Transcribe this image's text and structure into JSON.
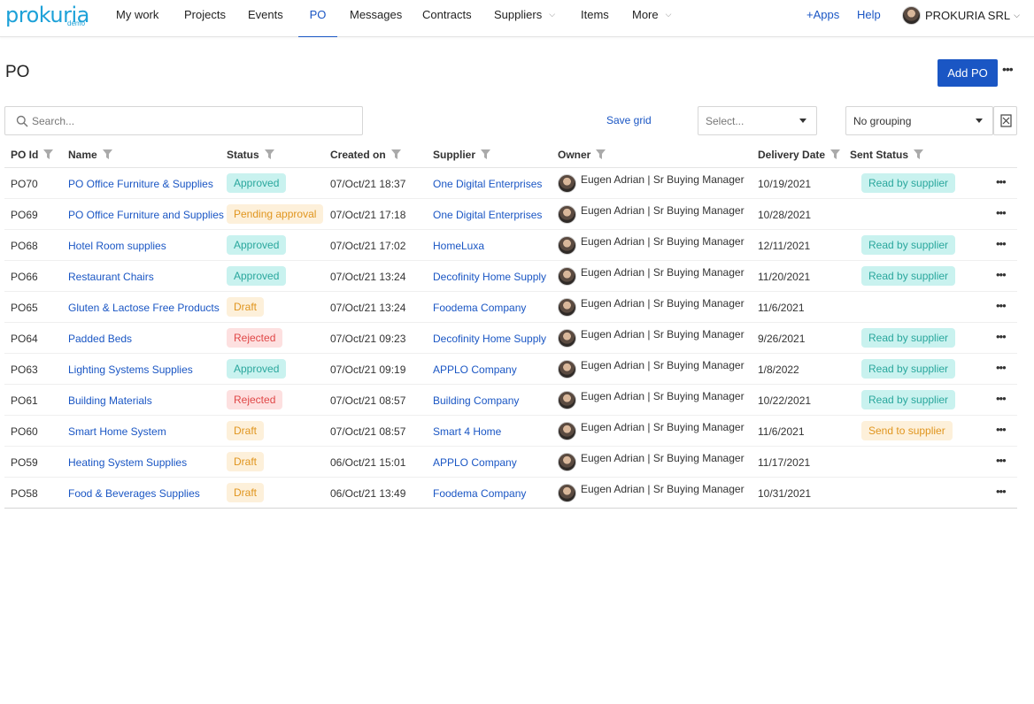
{
  "app": {
    "logo": "prokuria",
    "logo_sub": "demo"
  },
  "nav": {
    "items": [
      {
        "label": "My work"
      },
      {
        "label": "Projects"
      },
      {
        "label": "Events"
      },
      {
        "label": "PO",
        "active": true
      },
      {
        "label": "Messages"
      },
      {
        "label": "Contracts"
      },
      {
        "label": "Suppliers",
        "dropdown": true
      },
      {
        "label": "Items"
      },
      {
        "label": "More",
        "dropdown": true
      }
    ],
    "apps_label": "+Apps",
    "help_label": "Help",
    "user_label": "PROKURIA SRL"
  },
  "page": {
    "title": "PO",
    "add_button": "Add PO",
    "more_icon": "ellipsis-icon"
  },
  "toolbar": {
    "search_placeholder": "Search...",
    "search_value": "",
    "save_grid_label": "Save grid",
    "select_placeholder": "Select...",
    "grouping_value": "No grouping",
    "export_icon": "excel-export-icon"
  },
  "table": {
    "columns": [
      "PO Id",
      "Name",
      "Status",
      "Created on",
      "Supplier",
      "Owner",
      "Delivery Date",
      "Sent Status"
    ],
    "rows": [
      {
        "id": "PO70",
        "name": "PO Office Furniture & Supplies",
        "status": "Approved",
        "created": "07/Oct/21 18:37",
        "supplier": "One Digital Enterprises",
        "owner": "Eugen Adrian | Sr Buying Manager",
        "delivery": "10/19/2021",
        "sent": "Read by supplier"
      },
      {
        "id": "PO69",
        "name": "PO Office Furniture and Supplies",
        "status": "Pending approval",
        "created": "07/Oct/21 17:18",
        "supplier": "One Digital Enterprises",
        "owner": "Eugen Adrian | Sr Buying Manager",
        "delivery": "10/28/2021",
        "sent": ""
      },
      {
        "id": "PO68",
        "name": "Hotel Room supplies",
        "status": "Approved",
        "created": "07/Oct/21 17:02",
        "supplier": "HomeLuxa",
        "owner": "Eugen Adrian | Sr Buying Manager",
        "delivery": "12/11/2021",
        "sent": "Read by supplier"
      },
      {
        "id": "PO66",
        "name": "Restaurant Chairs",
        "status": "Approved",
        "created": "07/Oct/21 13:24",
        "supplier": "Decofinity Home Supply",
        "owner": "Eugen Adrian | Sr Buying Manager",
        "delivery": "11/20/2021",
        "sent": "Read by supplier"
      },
      {
        "id": "PO65",
        "name": "Gluten & Lactose Free Products",
        "status": "Draft",
        "created": "07/Oct/21 13:24",
        "supplier": "Foodema Company",
        "owner": "Eugen Adrian | Sr Buying Manager",
        "delivery": "11/6/2021",
        "sent": ""
      },
      {
        "id": "PO64",
        "name": "Padded Beds",
        "status": "Rejected",
        "created": "07/Oct/21 09:23",
        "supplier": "Decofinity Home Supply",
        "owner": "Eugen Adrian | Sr Buying Manager",
        "delivery": "9/26/2021",
        "sent": "Read by supplier"
      },
      {
        "id": "PO63",
        "name": "Lighting Systems Supplies",
        "status": "Approved",
        "created": "07/Oct/21 09:19",
        "supplier": "APPLO Company",
        "owner": "Eugen Adrian | Sr Buying Manager",
        "delivery": "1/8/2022",
        "sent": "Read by supplier"
      },
      {
        "id": "PO61",
        "name": "Building Materials",
        "status": "Rejected",
        "created": "07/Oct/21 08:57",
        "supplier": "Building Company",
        "owner": "Eugen Adrian | Sr Buying Manager",
        "delivery": "10/22/2021",
        "sent": "Read by supplier"
      },
      {
        "id": "PO60",
        "name": "Smart Home System",
        "status": "Draft",
        "created": "07/Oct/21 08:57",
        "supplier": "Smart 4 Home",
        "owner": "Eugen Adrian | Sr Buying Manager",
        "delivery": "11/6/2021",
        "sent": "Send to supplier"
      },
      {
        "id": "PO59",
        "name": "Heating System Supplies",
        "status": "Draft",
        "created": "06/Oct/21 15:01",
        "supplier": "APPLO Company",
        "owner": "Eugen Adrian | Sr Buying Manager",
        "delivery": "11/17/2021",
        "sent": ""
      },
      {
        "id": "PO58",
        "name": "Food & Beverages Supplies",
        "status": "Draft",
        "created": "06/Oct/21 13:49",
        "supplier": "Foodema Company",
        "owner": "Eugen Adrian | Sr Buying Manager",
        "delivery": "10/31/2021",
        "sent": ""
      }
    ]
  },
  "colors": {
    "accent": "#1a56c4",
    "approved_bg": "#c9f2ef",
    "approved_fg": "#2aa79d",
    "draft_bg": "#fdf0da",
    "draft_fg": "#e0951e",
    "rejected_bg": "#fde0e0",
    "rejected_fg": "#e04747"
  }
}
